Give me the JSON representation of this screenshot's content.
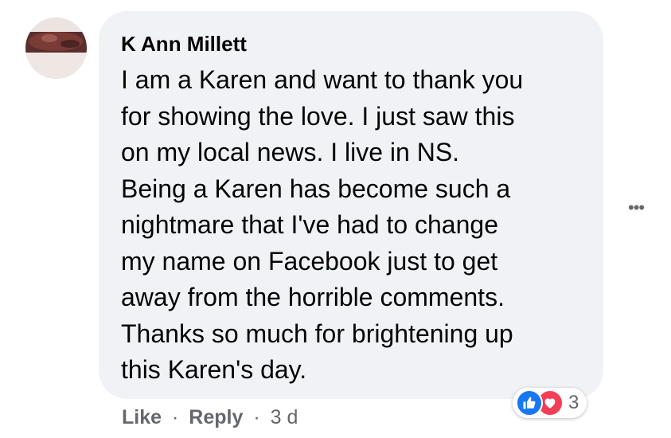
{
  "comment": {
    "author": "K Ann Millett",
    "text_lines": [
      "I am a Karen and want to thank you",
      "for showing the love. I just saw this",
      "on my local news. I live in NS.",
      "Being a Karen has become such a",
      "nightmare that I've had to change",
      "my name on Facebook just to get",
      "away from the horrible comments.",
      "Thanks so much for brightening up",
      "this Karen's day."
    ],
    "reactions": {
      "icons": [
        "like-icon",
        "love-icon"
      ],
      "count": "3",
      "like_color": "#1877f2",
      "love_color": "#f33e58"
    },
    "more_options_label": "•••"
  },
  "actions": {
    "like_label": "Like",
    "separator": "·",
    "reply_label": "Reply",
    "timestamp": "3 d"
  },
  "colors": {
    "bubble_background": "#f0f2f5",
    "text": "#050505",
    "secondary_text": "#65676b"
  }
}
